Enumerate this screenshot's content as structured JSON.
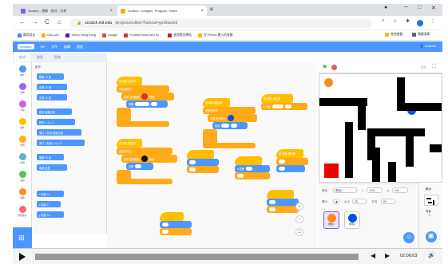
{
  "browser": {
    "tabs": [
      {
        "title": "Scratch - 想像 · 程式 · 分享"
      },
      {
        "title": "Scratch - Imagine, Program, Share"
      }
    ],
    "new_tab": "+",
    "window_controls": {
      "minimize": "─",
      "maximize": "□",
      "close": "✕"
    },
    "nav": {
      "back": "←",
      "forward": "→",
      "reload": "C",
      "home": "⌂"
    },
    "url": {
      "host": "scratch.mit.edu",
      "path": "/projects/editor/?tutorial=getStarted"
    },
    "bookmarks": [
      "應用程式",
      "Edu.com",
      "Yahoo Hong Kong",
      "Google",
      "Football News and Sc...",
      "香港電台網站",
      "在 Firefox 匯入的書籤"
    ],
    "bookmarks_right": [
      "其他書籤",
      "閱讀清單"
    ]
  },
  "scratch": {
    "logo": "Scratch",
    "menu": [
      "文件",
      "編輯",
      "教程"
    ],
    "user": "bnasset",
    "editor_tabs": [
      "程式",
      "造型",
      "音效"
    ],
    "categories": [
      "動作",
      "外觀",
      "音效",
      "事件",
      "控制",
      "偵測",
      "運算",
      "變數",
      "我的積木"
    ],
    "category_colors": [
      "#4c97ff",
      "#9966ff",
      "#cf63cf",
      "#ffbf00",
      "#ffab19",
      "#5cb1d6",
      "#59c059",
      "#ff8c1a",
      "#ff6680"
    ],
    "palette_header": "動作",
    "palette_blocks": [
      "移動 10 點",
      "右轉 15 度",
      "左轉 15 度",
      "移到 隨機位置",
      "移到 x: 0 y: 0",
      "滑行 1 秒到 隨機位置",
      "滑行 1 秒到 x: 0 y: 0",
      "面朝 90 度",
      "面朝 鼠標",
      "x 改變 10",
      "x 設為 0",
      "y 改變 10"
    ],
    "code_blocks": {
      "hat1": "當 綠旗 被點擊",
      "hat2": "當 綠旗 被點擊",
      "hat3": "當 綠旗 被點擊",
      "hat4": "當 綠旗 被點擊",
      "hat5": "當 綠旗 被點擊",
      "loop": "重複無限次",
      "if_touch": "如果 碰到顏色",
      "then": "那麼",
      "move": "移動",
      "turn": "右轉",
      "change": "x 改變",
      "set": "設為"
    },
    "sprite_panel": {
      "sprite_label": "角色",
      "sprite_name": "角色1",
      "x_label": "x",
      "x_value": "-214",
      "y_label": "y",
      "y_value": "141",
      "show_label": "顯示",
      "size_label": "大小",
      "size_value": "20",
      "direction_label": "方向",
      "direction_value": "90",
      "sprites": [
        {
          "name": "角色1",
          "color": "#ff8c1a"
        },
        {
          "name": "角色2",
          "color": "#0057d9"
        }
      ]
    },
    "stage_panel": {
      "label": "舞台",
      "backdrops_label": "背景",
      "backdrops_count": "1"
    }
  },
  "player": {
    "time": "02:06:03",
    "volume_icon": "volume-icon"
  }
}
